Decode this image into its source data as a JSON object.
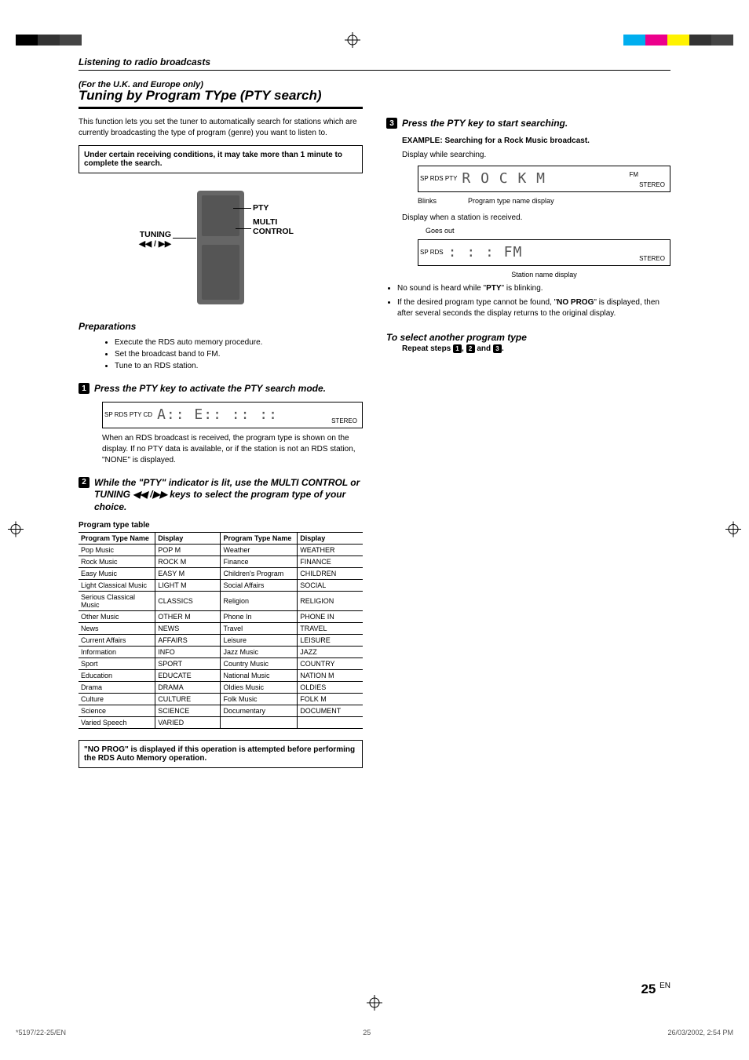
{
  "section_heading": "Listening to radio broadcasts",
  "subtitle_small": "(For the U.K. and Europe only)",
  "title_large": "Tuning by Program TYpe (PTY search)",
  "intro": "This function lets you set the tuner to automatically search for stations which are currently broadcasting the type of program (genre) you want to listen to.",
  "note_box": "Under certain receiving conditions, it may take more than 1 minute to complete the search.",
  "remote_labels": {
    "tuning": "TUNING",
    "arrows": "◀◀ / ▶▶",
    "pty": "PTY",
    "multi": "MULTI",
    "control": "CONTROL"
  },
  "preparations_heading": "Preparations",
  "prep_items": [
    "Execute the RDS auto memory procedure.",
    "Set the broadcast band to FM.",
    "Tune to an RDS station."
  ],
  "step1": {
    "num": "1",
    "text": "Press the PTY key to activate the PTY search mode."
  },
  "display1_inds": "SP RDS PTY CD",
  "display1_seg": "A:: E::  :: ::",
  "display1_stereo": "STEREO",
  "after_step1": "When an RDS broadcast is received, the program type is shown on the display.  If no PTY data is available, or if the station is not an RDS station, \"NONE\" is displayed.",
  "step2": {
    "num": "2",
    "text": "While the \"PTY\" indicator is lit, use the MULTI CONTROL or TUNING ◀◀  /▶▶  keys to select the program type of your choice."
  },
  "pty_table_heading": "Program type table",
  "pty_headers": [
    "Program Type Name",
    "Display",
    "Program Type Name",
    "Display"
  ],
  "pty_rows": [
    [
      "Pop Music",
      "POP M",
      "Weather",
      "WEATHER"
    ],
    [
      "Rock Music",
      "ROCK M",
      "Finance",
      "FINANCE"
    ],
    [
      "Easy Music",
      "EASY M",
      "Children's Program",
      "CHILDREN"
    ],
    [
      "Light Classical Music",
      "LIGHT M",
      "Social Affairs",
      "SOCIAL"
    ],
    [
      "Serious Classical Music",
      "CLASSICS",
      "Religion",
      "RELIGION"
    ],
    [
      "Other Music",
      "OTHER M",
      "Phone In",
      "PHONE IN"
    ],
    [
      "News",
      "NEWS",
      "Travel",
      "TRAVEL"
    ],
    [
      "Current Affairs",
      "AFFAIRS",
      "Leisure",
      "LEISURE"
    ],
    [
      "Information",
      "INFO",
      "Jazz Music",
      "JAZZ"
    ],
    [
      "Sport",
      "SPORT",
      "Country Music",
      "COUNTRY"
    ],
    [
      "Education",
      "EDUCATE",
      "National Music",
      "NATION M"
    ],
    [
      "Drama",
      "DRAMA",
      "Oldies Music",
      "OLDIES"
    ],
    [
      "Culture",
      "CULTURE",
      "Folk Music",
      "FOLK M"
    ],
    [
      "Science",
      "SCIENCE",
      "Documentary",
      "DOCUMENT"
    ],
    [
      "Varied Speech",
      "VARIED",
      "",
      ""
    ]
  ],
  "no_prog_note": "\"NO PROG\" is displayed if this operation is attempted before performing the RDS Auto Memory operation.",
  "step3": {
    "num": "3",
    "text": "Press the PTY key to start searching."
  },
  "example_heading": "EXAMPLE:  Searching for a Rock Music broadcast.",
  "disp_searching": "Display while searching.",
  "disp_searching_seg": "R O C K M",
  "disp_searching_fm": "FM",
  "disp_searching_caps": {
    "blinks": "Blinks",
    "ptname": "Program type name display"
  },
  "disp_received": "Display when a station is received.",
  "goes_out": "Goes out",
  "disp_received_seg": "   : : :   FM",
  "station_cap": "Station name display",
  "bullets": [
    "No sound is heard while \"PTY\" is blinking.",
    "If the desired program type cannot be found, \"NO PROG\" is displayed, then after several seconds the display returns to the original display."
  ],
  "select_another": "To select another program type",
  "repeat_steps_pre": "Repeat steps ",
  "repeat_and": " and ",
  "repeat_steps_post": ".",
  "repeat_nums": [
    "1",
    "2",
    "3"
  ],
  "page_num": "25",
  "page_suffix": "EN",
  "footer": {
    "left": "*5197/22-25/EN",
    "center": "25",
    "right": "26/03/2002, 2:54 PM"
  }
}
